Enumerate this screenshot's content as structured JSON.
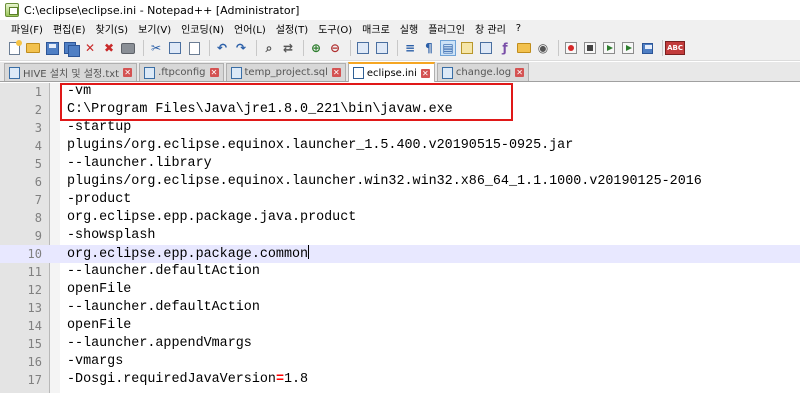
{
  "window": {
    "title": "C:\\eclipse\\eclipse.ini - Notepad++ [Administrator]"
  },
  "menu": [
    "파일(F)",
    "편집(E)",
    "찾기(S)",
    "보기(V)",
    "인코딩(N)",
    "언어(L)",
    "설정(T)",
    "도구(O)",
    "매크로",
    "실행",
    "플러그인",
    "창 관리",
    "?"
  ],
  "toolbar": {
    "buttons": [
      "new-file-icon",
      "open-file-icon",
      "save-icon",
      "save-all-icon",
      "close-icon",
      "close-all-icon",
      "print-icon",
      "cut-icon",
      "copy-icon",
      "paste-icon",
      "undo-icon",
      "redo-icon",
      "find-icon",
      "replace-icon",
      "zoom-in-icon",
      "zoom-out-icon",
      "sync-vertical-icon",
      "sync-horizontal-icon",
      "word-wrap-icon",
      "all-chars-icon",
      "indent-guide-icon",
      "udl-icon",
      "doc-map-icon",
      "function-list-icon",
      "folder-workspace-icon",
      "monitoring-icon",
      "record-macro-icon",
      "stop-macro-icon",
      "play-macro-icon",
      "run-macro-multiple-icon",
      "save-macro-icon",
      "spellcheck-icon"
    ],
    "spellcheck_label": "ABC"
  },
  "tabs": [
    {
      "label": "HIVE 설치 및 설정.txt",
      "active": false
    },
    {
      "label": ".ftpconfig",
      "active": false
    },
    {
      "label": "temp_project.sql",
      "active": false
    },
    {
      "label": "eclipse.ini",
      "active": true
    },
    {
      "label": "change.log",
      "active": false
    }
  ],
  "editor": {
    "current_line": 10,
    "lines": [
      {
        "n": "1",
        "text": "-vm"
      },
      {
        "n": "2",
        "text": "C:\\Program Files\\Java\\jre1.8.0_221\\bin\\javaw.exe"
      },
      {
        "n": "3",
        "text": "-startup"
      },
      {
        "n": "4",
        "text": "plugins/org.eclipse.equinox.launcher_1.5.400.v20190515-0925.jar"
      },
      {
        "n": "5",
        "text": "--launcher.library"
      },
      {
        "n": "6",
        "text": "plugins/org.eclipse.equinox.launcher.win32.win32.x86_64_1.1.1000.v20190125-2016"
      },
      {
        "n": "7",
        "text": "-product"
      },
      {
        "n": "8",
        "text": "org.eclipse.epp.package.java.product"
      },
      {
        "n": "9",
        "text": "-showsplash"
      },
      {
        "n": "10",
        "text": "org.eclipse.epp.package.common"
      },
      {
        "n": "11",
        "text": "--launcher.defaultAction"
      },
      {
        "n": "12",
        "text": "openFile"
      },
      {
        "n": "13",
        "text": "--launcher.defaultAction"
      },
      {
        "n": "14",
        "text": "openFile"
      },
      {
        "n": "15",
        "text": "--launcher.appendVmargs"
      },
      {
        "n": "16",
        "text": "-vmargs"
      },
      {
        "n": "17",
        "text": "-Dosgi.requiredJavaVersion",
        "eq": "=",
        "after": "1.8"
      }
    ]
  },
  "colors": {
    "current_line": "#e8e8ff",
    "annotation_box": "#e01818",
    "active_tab_accent": "#f5a623",
    "operator": "#ff0000"
  }
}
